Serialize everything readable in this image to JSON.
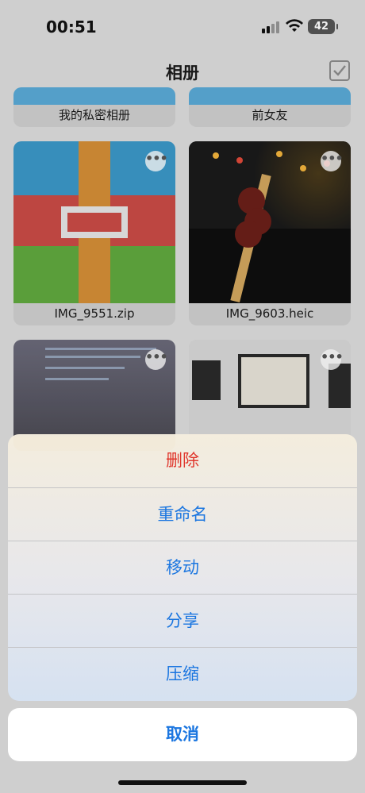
{
  "status_bar": {
    "time": "00:51",
    "battery": "42"
  },
  "nav": {
    "title": "相册"
  },
  "albums": [
    {
      "label": "我的私密相册"
    },
    {
      "label": "前女友"
    },
    {
      "label": "IMG_9551.zip"
    },
    {
      "label": "IMG_9603.heic"
    }
  ],
  "more_button_glyph": "•••",
  "action_sheet": {
    "items": [
      {
        "label": "删除",
        "style": "destructive"
      },
      {
        "label": "重命名",
        "style": "default"
      },
      {
        "label": "移动",
        "style": "default"
      },
      {
        "label": "分享",
        "style": "default"
      },
      {
        "label": "压缩",
        "style": "default"
      }
    ],
    "cancel": "取消"
  },
  "colors": {
    "accent": "#1b76e0",
    "destructive": "#e0362c"
  }
}
